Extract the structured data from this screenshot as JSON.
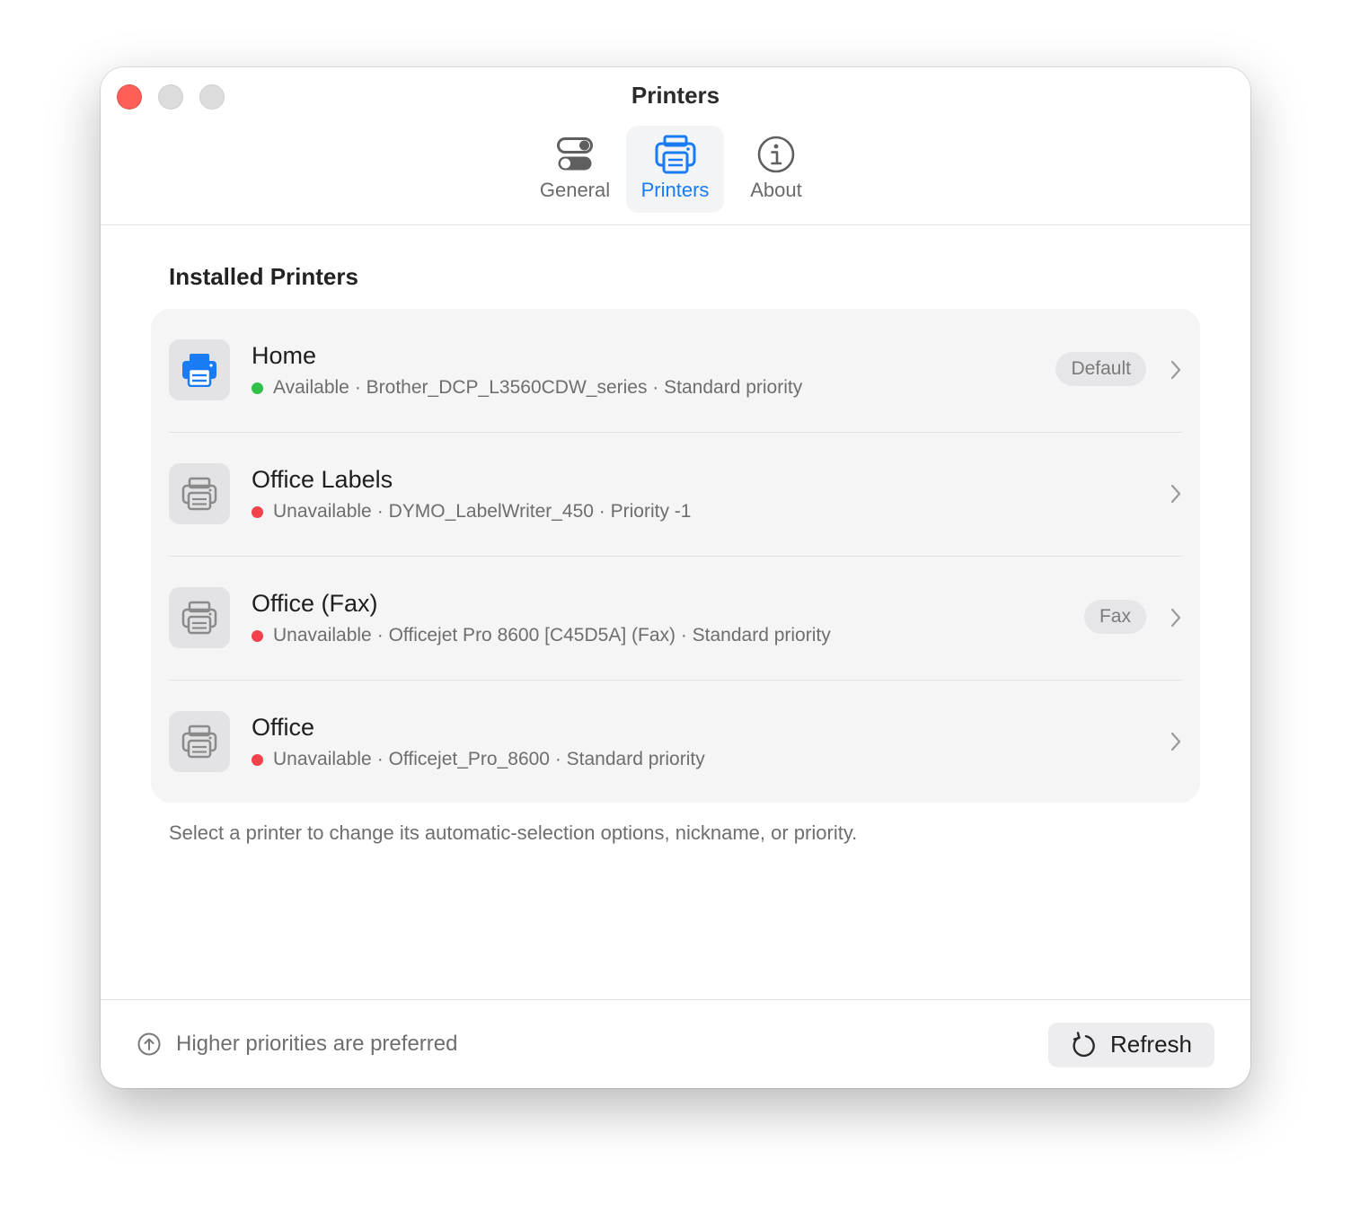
{
  "window": {
    "title": "Printers"
  },
  "toolbar": {
    "tabs": [
      {
        "label": "General",
        "icon": "toggles-icon",
        "active": false
      },
      {
        "label": "Printers",
        "icon": "printer-icon",
        "active": true
      },
      {
        "label": "About",
        "icon": "info-icon",
        "active": false
      }
    ]
  },
  "section": {
    "title": "Installed Printers"
  },
  "printers": [
    {
      "name": "Home",
      "status": "Available",
      "status_color": "#30c14a",
      "detail": "· Brother_DCP_L3560CDW_series · Standard priority",
      "badge": "Default",
      "icon_color": "#1a7cf5"
    },
    {
      "name": "Office Labels",
      "status": "Unavailable",
      "status_color": "#f2434d",
      "detail": "· DYMO_LabelWriter_450 · Priority -1",
      "badge": "",
      "icon_color": "#8a8a8a"
    },
    {
      "name": "Office (Fax)",
      "status": "Unavailable",
      "status_color": "#f2434d",
      "detail": "· Officejet Pro 8600 [C45D5A] (Fax) · Standard priority",
      "badge": "Fax",
      "icon_color": "#8a8a8a"
    },
    {
      "name": "Office",
      "status": "Unavailable",
      "status_color": "#f2434d",
      "detail": "· Officejet_Pro_8600 · Standard priority",
      "badge": "",
      "icon_color": "#8a8a8a"
    }
  ],
  "footnote": "Select a printer to change its automatic-selection options, nickname, or priority.",
  "footer": {
    "hint": "Higher priorities are preferred",
    "hint_icon": "arrow-up-circle-icon",
    "refresh_label": "Refresh",
    "refresh_icon": "refresh-icon"
  },
  "colors": {
    "accent": "#1a7cf5",
    "close": "#ff5f57"
  }
}
